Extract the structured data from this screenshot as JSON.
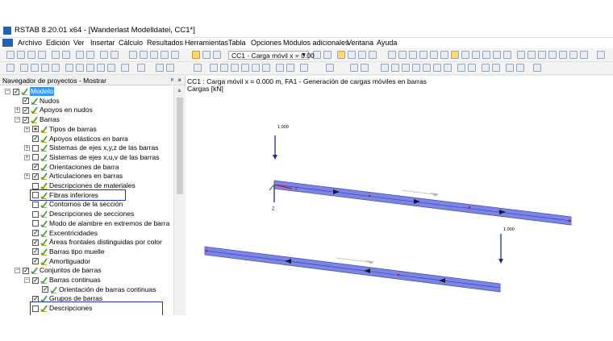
{
  "window": {
    "title": "RSTAB 8.20.01 x64 - [Wanderlast Modelldatei, CC1*]"
  },
  "menu": [
    "Archivo",
    "Edición",
    "Ver",
    "Insertar",
    "Cálculo",
    "Resultados",
    "Herramientas",
    "Tabla",
    "Opciones",
    "Módulos adicionales",
    "Ventana",
    "Ayuda"
  ],
  "toolbar": {
    "loadcase": "CC1 - Carga móvil x = 0.00"
  },
  "navigator": {
    "title": "Navegador de proyectos - Mostrar",
    "pin": "ᵖ",
    "close": "×",
    "items": [
      {
        "label": "Modelo"
      },
      {
        "label": "Nudos"
      },
      {
        "label": "Apoyos en nudos"
      },
      {
        "label": "Barras"
      },
      {
        "label": "Tipos de barras"
      },
      {
        "label": "Apoyos elásticos en barra"
      },
      {
        "label": "Sistemas de ejes x,y,z de las barras"
      },
      {
        "label": "Sistemas de ejes x,u,v de las barras"
      },
      {
        "label": "Orientaciones de barra"
      },
      {
        "label": "Articulaciones en barras"
      },
      {
        "label": "Descripciones de materiales"
      },
      {
        "label": "Fibras inferiores"
      },
      {
        "label": "Contornos de la sección"
      },
      {
        "label": "Descripciones de secciones"
      },
      {
        "label": "Modo de alambre en extremos de barra"
      },
      {
        "label": "Excentricidades"
      },
      {
        "label": "Áreas frontales distinguidas por color"
      },
      {
        "label": "Barras tipo muelle"
      },
      {
        "label": "Amortiguador"
      },
      {
        "label": "Conjuntos de barras"
      },
      {
        "label": "Barras continuas"
      },
      {
        "label": "Orientación de barras continuas"
      },
      {
        "label": "Grupos de barras"
      },
      {
        "label": "Descripciones"
      }
    ]
  },
  "view": {
    "info_line1": "CC1 : Carga móvil x = 0.000 m, FA1 -  Generación de cargas móviles en barras",
    "info_line2": "Cargas [kN]",
    "load_value_1": "1.000",
    "load_value_2": "1.000",
    "axis_z": "Z",
    "axis_x": "X"
  },
  "colors": {
    "beam": "#7b85e6",
    "beam_edge": "#4c55b8",
    "highlight": "#1f2fbf",
    "selected": "#3399ff"
  }
}
